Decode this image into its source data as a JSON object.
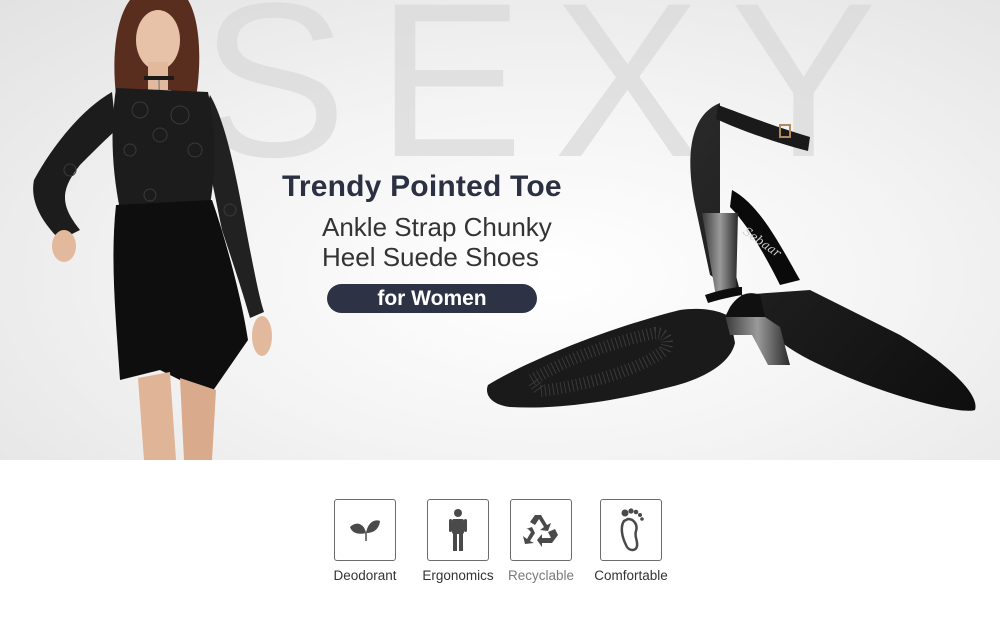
{
  "hero": {
    "watermark": "SEXY",
    "headline": "Trendy Pointed Toe",
    "subline_1": "Ankle Strap Chunky",
    "subline_2": "Heel Suede Shoes",
    "pill_text": "for Women",
    "insole_brand": "Sebaar"
  },
  "features": [
    {
      "label": "Deodorant",
      "icon": "leaf-icon"
    },
    {
      "label": "Ergonomics",
      "icon": "person-icon"
    },
    {
      "label": "Recyclable",
      "icon": "recycle-icon"
    },
    {
      "label": "Comfortable",
      "icon": "footprint-icon"
    }
  ],
  "colors": {
    "headline": "#2b3142",
    "pill_bg": "#2d3345",
    "icon_gray": "#4a4a4a"
  }
}
